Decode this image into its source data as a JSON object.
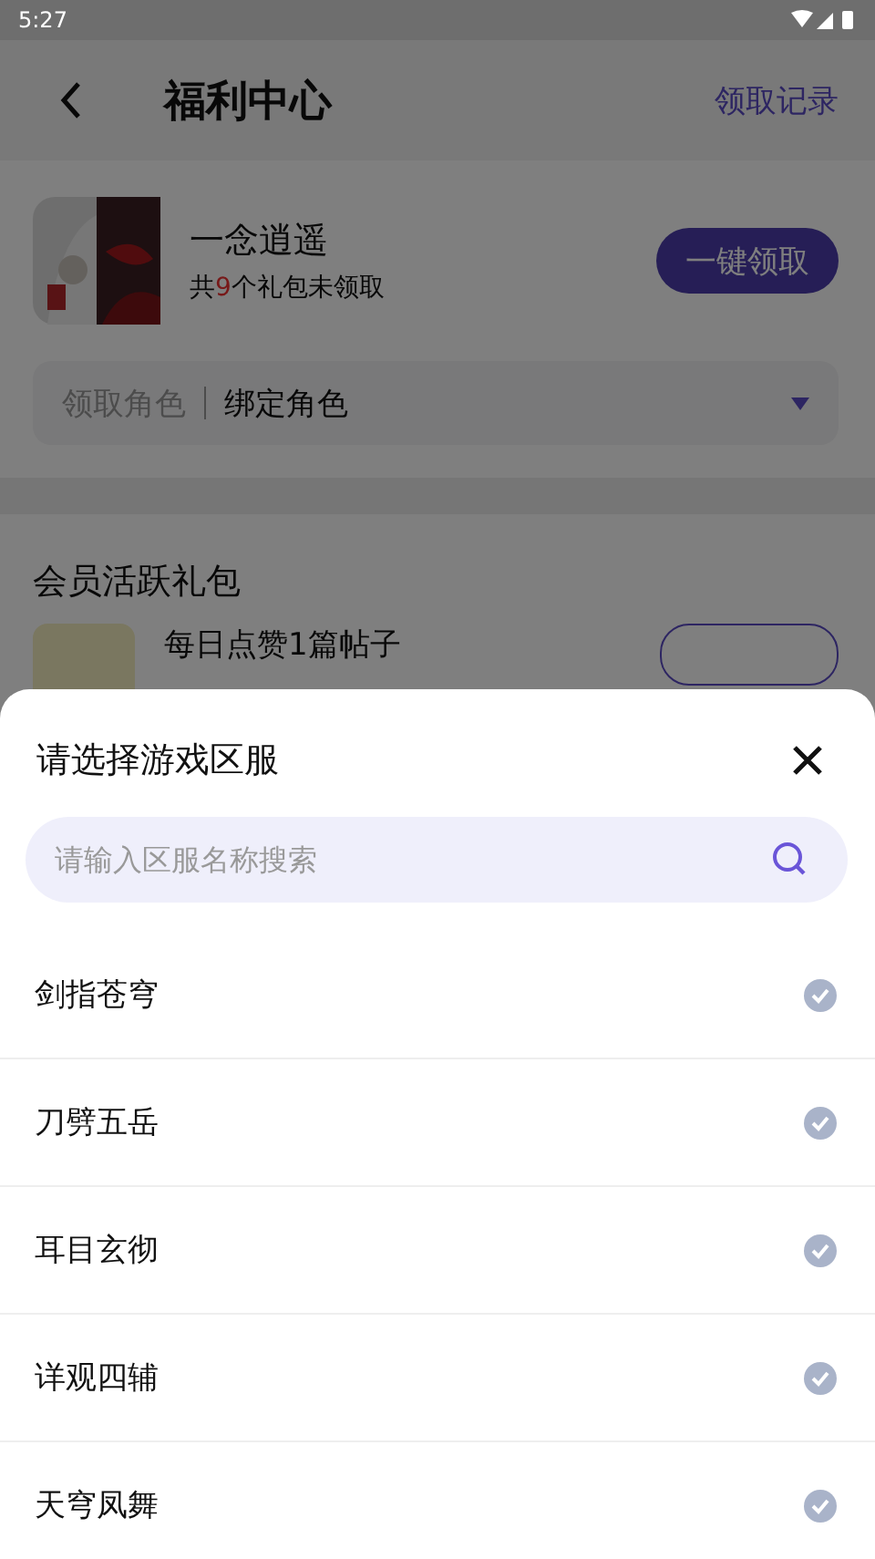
{
  "status_bar": {
    "time": "5:27"
  },
  "header": {
    "title": "福利中心",
    "action": "领取记录"
  },
  "game": {
    "name": "一念逍遥",
    "summary": "共**9**个礼包未领取",
    "claim_all_button": "一键领取"
  },
  "role_selector": {
    "label": "领取角色",
    "value": "绑定角色"
  },
  "section": {
    "title": "会员活跃礼包",
    "tasks": [
      {
        "title": "每日点赞1篇帖子"
      }
    ]
  },
  "server_sheet": {
    "title": "请选择游戏区服",
    "search": {
      "placeholder": "请输入区服名称搜索"
    },
    "servers": [
      {
        "name": "剑指苍穹",
        "selected": false
      },
      {
        "name": "刀劈五岳",
        "selected": false
      },
      {
        "name": "耳目玄彻",
        "selected": false
      },
      {
        "name": "详观四辅",
        "selected": false
      },
      {
        "name": "天穹凤舞",
        "selected": false
      }
    ]
  }
}
